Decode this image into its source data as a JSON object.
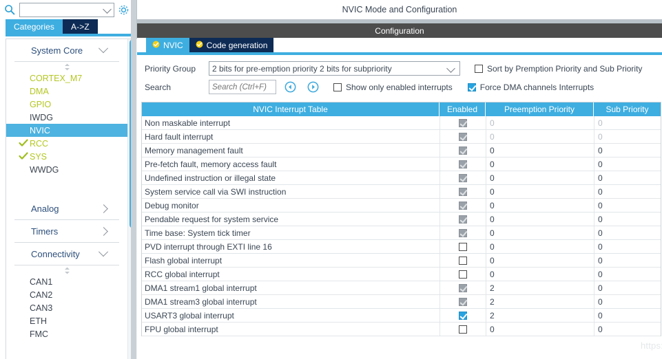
{
  "left": {
    "search": {
      "value": "",
      "placeholder": ""
    },
    "gear_icon": "gear-icon",
    "search_icon": "search-icon",
    "tabs": [
      {
        "label": "Categories",
        "active": true
      },
      {
        "label": "A->Z",
        "active": false
      }
    ],
    "groups": [
      {
        "label": "System Core",
        "expanded": true,
        "items": [
          {
            "label": "CORTEX_M7",
            "color": "green",
            "checked": false,
            "selected": false
          },
          {
            "label": "DMA",
            "color": "green",
            "checked": false,
            "selected": false
          },
          {
            "label": "GPIO",
            "color": "green",
            "checked": false,
            "selected": false
          },
          {
            "label": "IWDG",
            "color": "dark",
            "checked": false,
            "selected": false
          },
          {
            "label": "NVIC",
            "color": "dark",
            "checked": false,
            "selected": true
          },
          {
            "label": "RCC",
            "color": "green",
            "checked": true,
            "selected": false
          },
          {
            "label": "SYS",
            "color": "green",
            "checked": true,
            "selected": false
          },
          {
            "label": "WWDG",
            "color": "dark",
            "checked": false,
            "selected": false
          }
        ]
      },
      {
        "label": "Analog",
        "expanded": false,
        "items": []
      },
      {
        "label": "Timers",
        "expanded": false,
        "items": []
      },
      {
        "label": "Connectivity",
        "expanded": true,
        "items": [
          {
            "label": "CAN1",
            "color": "dark",
            "checked": false,
            "selected": false
          },
          {
            "label": "CAN2",
            "color": "dark",
            "checked": false,
            "selected": false
          },
          {
            "label": "CAN3",
            "color": "dark",
            "checked": false,
            "selected": false
          },
          {
            "label": "ETH",
            "color": "dark",
            "checked": false,
            "selected": false
          },
          {
            "label": "FMC",
            "color": "dark",
            "checked": false,
            "selected": false
          }
        ]
      }
    ]
  },
  "right": {
    "page_title": "NVIC Mode and Configuration",
    "configuration_bar": "Configuration",
    "tabs": [
      {
        "label": "NVIC",
        "active": true
      },
      {
        "label": "Code generation",
        "active": false
      }
    ],
    "priority_group": {
      "label": "Priority Group",
      "value": "2 bits for pre-emption priority 2 bits for subpriority"
    },
    "sort_checkbox": {
      "label": "Sort by Premption Priority and Sub Priority",
      "checked": false
    },
    "search": {
      "label": "Search",
      "value": "",
      "placeholder": "Search (Ctrl+F)"
    },
    "nav_prev_icon": "circle-left-arrow-icon",
    "nav_next_icon": "circle-right-arrow-icon",
    "show_enabled_checkbox": {
      "label": "Show only enabled interrupts",
      "checked": false
    },
    "force_dma_checkbox": {
      "label": "Force DMA channels Interrupts",
      "checked": true
    },
    "table": {
      "headers": [
        "NVIC Interrupt Table",
        "Enabled",
        "Preemption Priority",
        "Sub Priority"
      ],
      "rows": [
        {
          "name": "Non maskable interrupt",
          "enabled": "checked-gray",
          "preemption": "0",
          "sub": "0",
          "dim": true
        },
        {
          "name": "Hard fault interrupt",
          "enabled": "checked-gray",
          "preemption": "0",
          "sub": "0",
          "dim": true
        },
        {
          "name": "Memory management fault",
          "enabled": "checked-gray",
          "preemption": "0",
          "sub": "0",
          "dim": false
        },
        {
          "name": "Pre-fetch fault, memory access fault",
          "enabled": "checked-gray",
          "preemption": "0",
          "sub": "0",
          "dim": false
        },
        {
          "name": "Undefined instruction or illegal state",
          "enabled": "checked-gray",
          "preemption": "0",
          "sub": "0",
          "dim": false
        },
        {
          "name": "System service call via SWI instruction",
          "enabled": "checked-gray",
          "preemption": "0",
          "sub": "0",
          "dim": false
        },
        {
          "name": "Debug monitor",
          "enabled": "checked-gray",
          "preemption": "0",
          "sub": "0",
          "dim": false
        },
        {
          "name": "Pendable request for system service",
          "enabled": "checked-gray",
          "preemption": "0",
          "sub": "0",
          "dim": false
        },
        {
          "name": "Time base: System tick timer",
          "enabled": "checked-gray",
          "preemption": "0",
          "sub": "0",
          "dim": false
        },
        {
          "name": "PVD interrupt through EXTI line 16",
          "enabled": "unchecked",
          "preemption": "0",
          "sub": "0",
          "dim": false
        },
        {
          "name": "Flash global interrupt",
          "enabled": "unchecked",
          "preemption": "0",
          "sub": "0",
          "dim": false
        },
        {
          "name": "RCC global interrupt",
          "enabled": "unchecked",
          "preemption": "0",
          "sub": "0",
          "dim": false
        },
        {
          "name": "DMA1 stream1 global interrupt",
          "enabled": "checked-gray",
          "preemption": "2",
          "sub": "0",
          "dim": false
        },
        {
          "name": "DMA1 stream3 global interrupt",
          "enabled": "checked-gray",
          "preemption": "2",
          "sub": "0",
          "dim": false
        },
        {
          "name": "USART3 global interrupt",
          "enabled": "checked-blue",
          "preemption": "2",
          "sub": "0",
          "dim": false
        },
        {
          "name": "FPU global interrupt",
          "enabled": "unchecked",
          "preemption": "0",
          "sub": "0",
          "dim": false
        }
      ]
    }
  },
  "watermark": "https://blog.csdn.net/weifengdq",
  "colors": {
    "accent_blue": "#3eaee0",
    "dark_navy": "#0d2b55",
    "gray_bar": "#4d4d4d",
    "green_text": "#b4c722"
  }
}
